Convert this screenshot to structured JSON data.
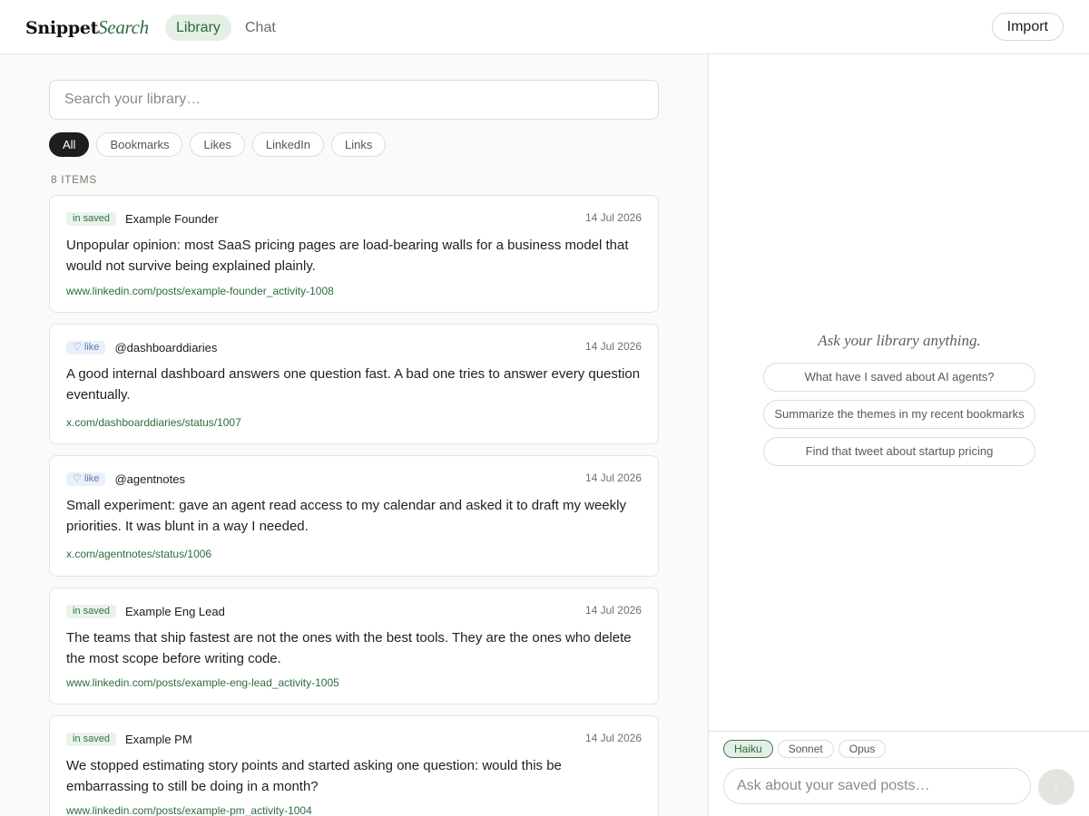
{
  "header": {
    "logo_part1": "Snippet",
    "logo_part2": "Search",
    "tabs": [
      {
        "label": "Library",
        "active": true
      },
      {
        "label": "Chat",
        "active": false
      }
    ],
    "import_label": "Import"
  },
  "library": {
    "search_placeholder": "Search your library…",
    "filters": [
      {
        "label": "All",
        "active": true
      },
      {
        "label": "Bookmarks",
        "active": false
      },
      {
        "label": "Likes",
        "active": false
      },
      {
        "label": "LinkedIn",
        "active": false
      },
      {
        "label": "Links",
        "active": false
      }
    ],
    "count_label": "8 ITEMS",
    "items": [
      {
        "badge": "in saved",
        "badge_type": "saved",
        "author": "Example Founder",
        "date": "14 Jul 2026",
        "text": "Unpopular opinion: most SaaS pricing pages are load-bearing walls for a business model that would not survive being explained plainly.",
        "link": "www.linkedin.com/posts/example-founder_activity-1008"
      },
      {
        "badge": "♡ like",
        "badge_type": "like",
        "author": "@dashboarddiaries",
        "date": "14 Jul 2026",
        "text": "A good internal dashboard answers one question fast. A bad one tries to answer every question eventually.",
        "link": "x.com/dashboarddiaries/status/1007"
      },
      {
        "badge": "♡ like",
        "badge_type": "like",
        "author": "@agentnotes",
        "date": "14 Jul 2026",
        "text": "Small experiment: gave an agent read access to my calendar and asked it to draft my weekly priorities. It was blunt in a way I needed.",
        "link": "x.com/agentnotes/status/1006"
      },
      {
        "badge": "in saved",
        "badge_type": "saved",
        "author": "Example Eng Lead",
        "date": "14 Jul 2026",
        "text": "The teams that ship fastest are not the ones with the best tools. They are the ones who delete the most scope before writing code.",
        "link": "www.linkedin.com/posts/example-eng-lead_activity-1005"
      },
      {
        "badge": "in saved",
        "badge_type": "saved",
        "author": "Example PM",
        "date": "14 Jul 2026",
        "text": "We stopped estimating story points and started asking one question: would this be embarrassing to still be doing in a month?",
        "link": "www.linkedin.com/posts/example-pm_activity-1004"
      }
    ]
  },
  "chat": {
    "prompt_title": "Ask your library anything.",
    "suggestions": [
      "What have I saved about AI agents?",
      "Summarize the themes in my recent bookmarks",
      "Find that tweet about startup pricing"
    ],
    "models": [
      {
        "label": "Haiku",
        "active": true
      },
      {
        "label": "Sonnet",
        "active": false
      },
      {
        "label": "Opus",
        "active": false
      }
    ],
    "input_placeholder": "Ask about your saved posts…",
    "send_icon": "↑"
  }
}
